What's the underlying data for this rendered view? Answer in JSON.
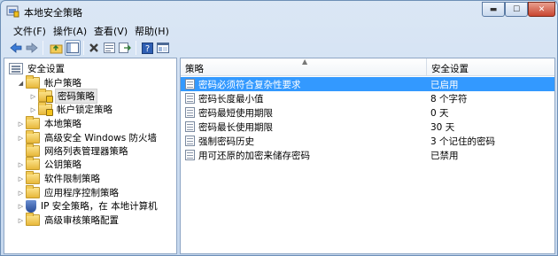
{
  "window": {
    "title": "本地安全策略"
  },
  "menu": [
    {
      "label": "文件(F)"
    },
    {
      "label": "操作(A)"
    },
    {
      "label": "查看(V)"
    },
    {
      "label": "帮助(H)"
    }
  ],
  "toolbar": {
    "buttons": [
      {
        "icon": "back-arrow-icon"
      },
      {
        "icon": "forward-arrow-icon"
      },
      {
        "icon": "up-folder-icon"
      },
      {
        "icon": "show-hide-tree-icon"
      },
      {
        "icon": "delete-icon"
      },
      {
        "icon": "properties-icon"
      },
      {
        "icon": "export-list-icon"
      },
      {
        "icon": "help-icon"
      },
      {
        "icon": "console-icon"
      }
    ]
  },
  "tree": [
    {
      "label": "安全设置",
      "icon": "settings"
    },
    {
      "label": "帐户策略",
      "icon": "folder"
    },
    {
      "label": "密码策略",
      "icon": "folder-lock"
    },
    {
      "label": "帐户锁定策略",
      "icon": "folder-lock"
    },
    {
      "label": "本地策略",
      "icon": "folder"
    },
    {
      "label": "高级安全 Windows 防火墙",
      "icon": "folder"
    },
    {
      "label": "网络列表管理器策略",
      "icon": "folder"
    },
    {
      "label": "公钥策略",
      "icon": "folder"
    },
    {
      "label": "软件限制策略",
      "icon": "folder"
    },
    {
      "label": "应用程序控制策略",
      "icon": "folder"
    },
    {
      "label": "IP 安全策略，在 本地计算机",
      "icon": "shield"
    },
    {
      "label": "高级审核策略配置",
      "icon": "folder"
    }
  ],
  "table": {
    "columns": [
      "策略",
      "安全设置"
    ],
    "rows": [
      {
        "policy": "密码必须符合复杂性要求",
        "setting": "已启用"
      },
      {
        "policy": "密码长度最小值",
        "setting": "8 个字符"
      },
      {
        "policy": "密码最短使用期限",
        "setting": "0 天"
      },
      {
        "policy": "密码最长使用期限",
        "setting": "30 天"
      },
      {
        "policy": "强制密码历史",
        "setting": "3 个记住的密码"
      },
      {
        "policy": "用可还原的加密来储存密码",
        "setting": "已禁用"
      }
    ]
  },
  "colors": {
    "selection": "#3399ff",
    "accent": "#6d8fb6"
  }
}
